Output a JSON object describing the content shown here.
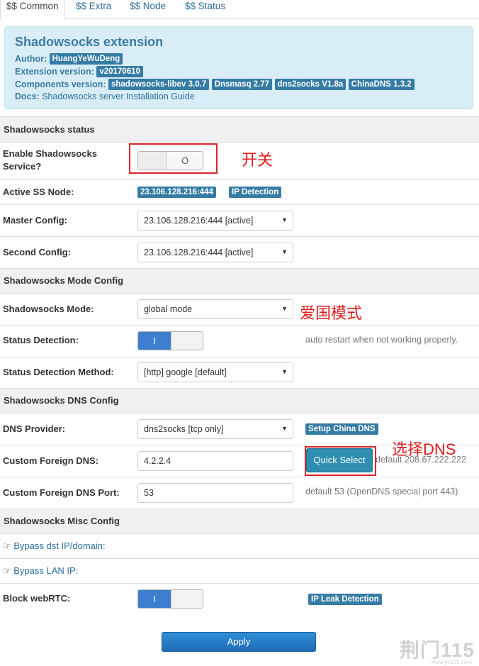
{
  "tabs": [
    "$$ Common",
    "$$ Extra",
    "$$ Node",
    "$$ Status"
  ],
  "info": {
    "title": "Shadowsocks extension",
    "author_label": "Author:",
    "author": "HuangYeWuDeng",
    "version_label": "Extension version:",
    "version": "v20170610",
    "components_label": "Components version:",
    "components": [
      "shadowsocks-libev 3.0.7",
      "Dnsmasq 2.77",
      "dns2socks V1.8a",
      "ChinaDNS 1.3.2"
    ],
    "docs_label": "Docs:",
    "docs_text1": "Shadowsocks server",
    "docs_text2": "Installation Guide"
  },
  "status_section": {
    "title": "Shadowsocks status",
    "enable_label": "Enable Shadowsocks Service?",
    "enable_state": "off",
    "active_node_label": "Active SS Node:",
    "active_node": "23.106.128.216:444",
    "ip_detection": "IP Detection",
    "master_label": "Master Config:",
    "master_value": "23.106.128.216:444 [active]",
    "second_label": "Second Config:",
    "second_value": "23.106.128.216:444 [active]"
  },
  "mode_section": {
    "title": "Shadowsocks Mode Config",
    "mode_label": "Shadowsocks Mode:",
    "mode_value": "global mode",
    "detect_label": "Status Detection:",
    "detect_state": "on",
    "detect_hint": "auto restart when not working properly.",
    "method_label": "Status Detection Method:",
    "method_value": "[http] google [default]"
  },
  "dns_section": {
    "title": "Shadowsocks DNS Config",
    "provider_label": "DNS Provider:",
    "provider_value": "dns2socks [tcp only]",
    "setup_china_dns": "Setup China DNS",
    "foreign_label": "Custom Foreign DNS:",
    "foreign_value": "4.2.2.4",
    "quick_select": "Quick Select",
    "foreign_hint": "default 208.67.222.222",
    "port_label": "Custom Foreign DNS Port:",
    "port_value": "53",
    "port_hint": "default 53 (OpenDNS special port 443)"
  },
  "misc_section": {
    "title": "Shadowsocks Misc Config",
    "bypass_dst": "Bypass dst IP/domain:",
    "bypass_lan": "Bypass LAN IP:",
    "webrtc_label": "Block webRTC:",
    "webrtc_state": "on",
    "ip_leak": "IP Leak Detection"
  },
  "switch_on_glyph": "I",
  "switch_off_glyph": "O",
  "apply_label": "Apply",
  "annotations": {
    "switch_note": "开关",
    "mode_note": "爱国模式",
    "dns_note": "选择DNS"
  },
  "watermark": {
    "brand": "荆门115",
    "url": "www.jm115.com"
  },
  "colors": {
    "accent": "#357ca5",
    "annotation_red": "#e21b1b",
    "switch_on": "#3d7fcf"
  }
}
